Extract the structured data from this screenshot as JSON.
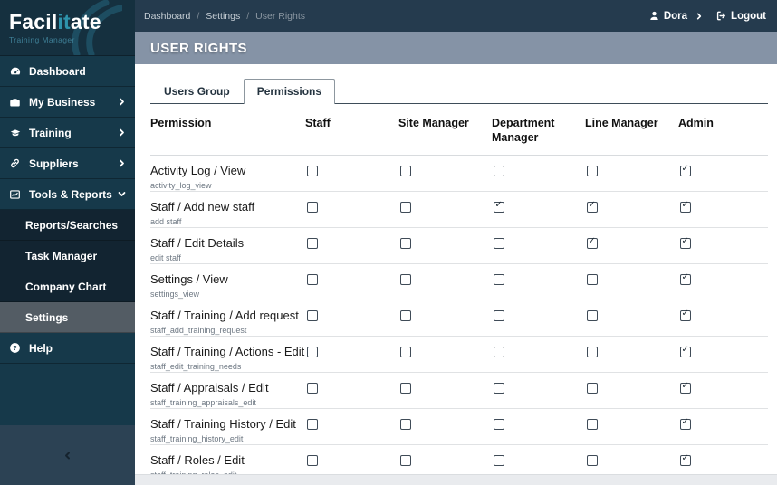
{
  "branding": {
    "logo_part1": "Facil",
    "logo_accent": "it",
    "logo_part2": "ate",
    "subtitle": "Training Manager",
    "accent_color": "#2E93AC"
  },
  "topbar": {
    "breadcrumb": [
      "Dashboard",
      "Settings",
      "User Rights"
    ],
    "separator": "/",
    "user_name": "Dora",
    "logout_label": "Logout"
  },
  "page": {
    "title": "USER RIGHTS"
  },
  "tabs": [
    {
      "label": "Users Group",
      "active": false
    },
    {
      "label": "Permissions",
      "active": true
    }
  ],
  "sidebar": {
    "items": [
      {
        "label": "Dashboard",
        "icon": "dashboard-icon",
        "chevron": "none"
      },
      {
        "label": "My Business",
        "icon": "briefcase-icon",
        "chevron": "right"
      },
      {
        "label": "Training",
        "icon": "graduation-cap-icon",
        "chevron": "right"
      },
      {
        "label": "Suppliers",
        "icon": "link-icon",
        "chevron": "right"
      },
      {
        "label": "Tools & Reports",
        "icon": "chart-line-icon",
        "chevron": "down",
        "expanded": true
      }
    ],
    "submenu": [
      {
        "label": "Reports/Searches",
        "active": false
      },
      {
        "label": "Task Manager",
        "active": false
      },
      {
        "label": "Company Chart",
        "active": false
      },
      {
        "label": "Settings",
        "active": true
      }
    ],
    "help_label": "Help",
    "collapse_icon": "chevron-left-icon"
  },
  "table": {
    "columns": [
      "Permission",
      "Staff",
      "Site Manager",
      "Department Manager",
      "Line Manager",
      "Admin"
    ],
    "rows": [
      {
        "name": "Activity Log / View",
        "code": "activity_log_view",
        "checks": [
          false,
          false,
          false,
          false,
          true
        ]
      },
      {
        "name": "Staff / Add new staff",
        "code": "add staff",
        "checks": [
          false,
          false,
          true,
          true,
          true
        ]
      },
      {
        "name": "Staff / Edit Details",
        "code": "edit staff",
        "checks": [
          false,
          false,
          false,
          true,
          true
        ]
      },
      {
        "name": "Settings / View",
        "code": "settings_view",
        "checks": [
          false,
          false,
          false,
          false,
          true
        ]
      },
      {
        "name": "Staff / Training / Add request",
        "code": "staff_add_training_request",
        "checks": [
          false,
          false,
          false,
          false,
          true
        ]
      },
      {
        "name": "Staff / Training / Actions - Edit",
        "code": "staff_edit_training_needs",
        "checks": [
          false,
          false,
          false,
          false,
          true
        ]
      },
      {
        "name": "Staff / Appraisals / Edit",
        "code": "staff_training_appraisals_edit",
        "checks": [
          false,
          false,
          false,
          false,
          true
        ]
      },
      {
        "name": "Staff / Training History / Edit",
        "code": "staff_training_history_edit",
        "checks": [
          false,
          false,
          false,
          false,
          true
        ]
      },
      {
        "name": "Staff / Roles / Edit",
        "code": "staff_training_roles_edit",
        "checks": [
          false,
          false,
          false,
          false,
          true
        ]
      }
    ]
  },
  "colors": {
    "sidebar_bg": "#16394A",
    "submenu_bg": "#122431",
    "topbar_bg": "#253B4E",
    "page_header_bg": "#8593A6",
    "active_item_bg": "#535C64",
    "accent": "#2E93AC"
  }
}
